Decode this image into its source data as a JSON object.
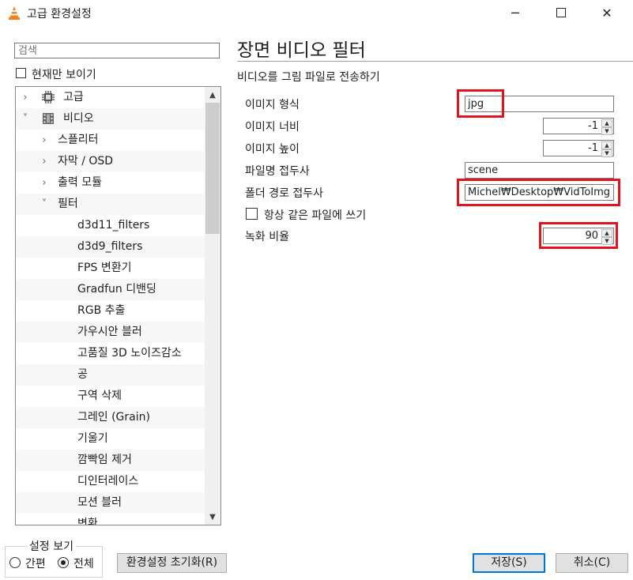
{
  "window": {
    "title": "고급 환경설정",
    "min_icon": "minimize-icon",
    "max_icon": "maximize-icon",
    "close_icon": "close-icon"
  },
  "left": {
    "search_placeholder": "검색",
    "current_only_label": "현재만 보이기",
    "tree": [
      {
        "label": "고급",
        "level": 0,
        "chevron": "›",
        "icon": "chip-icon"
      },
      {
        "label": "비디오",
        "level": 0,
        "chevron": "˅",
        "icon": "video-icon"
      },
      {
        "label": "스플리터",
        "level": 1,
        "chevron": "›"
      },
      {
        "label": "자막 / OSD",
        "level": 1,
        "chevron": "›"
      },
      {
        "label": "출력 모듈",
        "level": 1,
        "chevron": "›"
      },
      {
        "label": "필터",
        "level": 1,
        "chevron": "˅"
      },
      {
        "label": "d3d11_filters",
        "level": 2
      },
      {
        "label": "d3d9_filters",
        "level": 2
      },
      {
        "label": "FPS 변환기",
        "level": 2
      },
      {
        "label": "Gradfun 디밴딩",
        "level": 2
      },
      {
        "label": "RGB 추출",
        "level": 2
      },
      {
        "label": "가우시안 블러",
        "level": 2
      },
      {
        "label": "고품질 3D 노이즈감소",
        "level": 2
      },
      {
        "label": "공",
        "level": 2
      },
      {
        "label": "구역 삭제",
        "level": 2
      },
      {
        "label": "그레인 (Grain)",
        "level": 2
      },
      {
        "label": "기울기",
        "level": 2
      },
      {
        "label": "깜빡임 제거",
        "level": 2
      },
      {
        "label": "디인터레이스",
        "level": 2
      },
      {
        "label": "모션 블러",
        "level": 2
      },
      {
        "label": "변환",
        "level": 2
      }
    ]
  },
  "view": {
    "legend": "설정 보기",
    "simple": "간편",
    "all": "전체",
    "selected": "all"
  },
  "buttons": {
    "reset": "환경설정 초기화(R)",
    "save": "저장(S)",
    "cancel": "취소(C)"
  },
  "panel": {
    "title": "장면 비디오 필터",
    "subtitle": "비디오를 그림 파일로 전송하기",
    "fields": {
      "format_label": "이미지 형식",
      "format_value": "jpg",
      "width_label": "이미지 너비",
      "width_value": "-1",
      "height_label": "이미지 높이",
      "height_value": "-1",
      "prefix_label": "파일명 접두사",
      "prefix_value": "scene",
      "path_label": "폴더 경로 접두사",
      "path_value": "Michel₩Desktop₩VidToImg",
      "overwrite_label": "항상 같은 파일에 쓰기",
      "overwrite_checked": false,
      "ratio_label": "녹화 비율",
      "ratio_value": "90"
    }
  },
  "colors": {
    "highlight": "#e0141e",
    "accent": "#0078d7"
  }
}
